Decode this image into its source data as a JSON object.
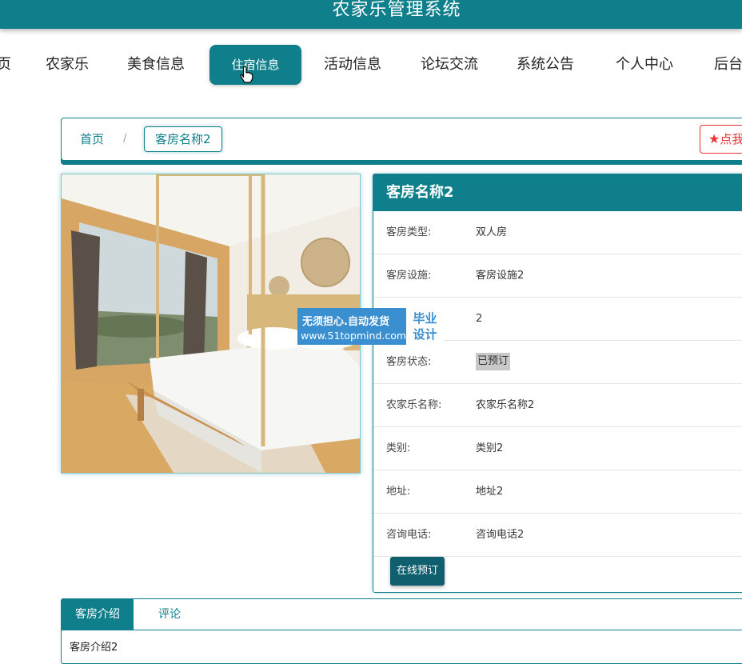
{
  "app": {
    "title": "农家乐管理系统"
  },
  "nav": {
    "items": [
      {
        "label": "页"
      },
      {
        "label": "农家乐"
      },
      {
        "label": "美食信息"
      },
      {
        "label": "住宿信息",
        "active": true
      },
      {
        "label": "活动信息"
      },
      {
        "label": "论坛交流"
      },
      {
        "label": "系统公告"
      },
      {
        "label": "个人中心"
      },
      {
        "label": "后台"
      }
    ]
  },
  "breadcrumb": {
    "home": "首页",
    "separator": "/",
    "current": "客房名称2",
    "favorite": "点我"
  },
  "watermark": {
    "line1": "无须担心.自动发货",
    "line2": "www.51topmind.com",
    "badge1": "毕业",
    "badge2": "设计"
  },
  "detail": {
    "title": "客房名称2",
    "rows": [
      {
        "key": "客房类型:",
        "value": "双人房"
      },
      {
        "key": "客房设施:",
        "value": "客房设施2"
      },
      {
        "key": "",
        "value": "2"
      },
      {
        "key": "客房状态:",
        "value": "已预订"
      },
      {
        "key": "农家乐名称:",
        "value": "农家乐名称2"
      },
      {
        "key": "类别:",
        "value": "类别2"
      },
      {
        "key": "地址:",
        "value": "地址2"
      },
      {
        "key": "咨询电话:",
        "value": "咨询电话2"
      }
    ],
    "book_label": "在线预订"
  },
  "tabs": {
    "items": [
      {
        "label": "客房介绍"
      },
      {
        "label": "评论"
      }
    ],
    "content": "客房介绍2"
  },
  "colors": {
    "primary": "#0f7f8c",
    "favorite": "#e33333",
    "watermark": "#3a8fd0"
  },
  "icons": {
    "favorite": "star-icon",
    "cursor": "hand-cursor-icon",
    "photo": "bedroom-photo"
  }
}
